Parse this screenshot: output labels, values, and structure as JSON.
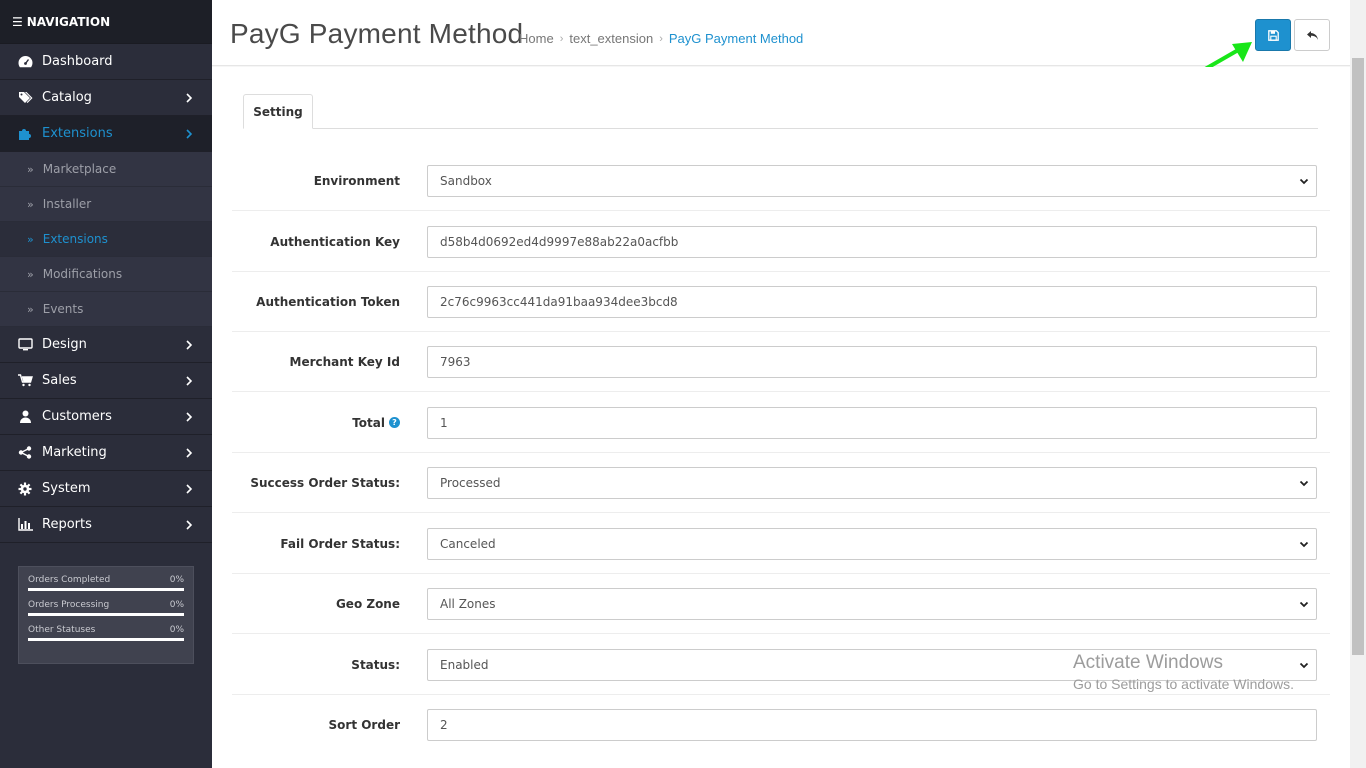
{
  "nav": {
    "title": "NAVIGATION",
    "items": [
      {
        "label": "Dashboard",
        "icon": "dashboard-icon"
      },
      {
        "label": "Catalog",
        "icon": "tags-icon"
      },
      {
        "label": "Extensions",
        "icon": "puzzle-icon"
      },
      {
        "label": "Design",
        "icon": "monitor-icon"
      },
      {
        "label": "Sales",
        "icon": "cart-icon"
      },
      {
        "label": "Customers",
        "icon": "user-icon"
      },
      {
        "label": "Marketing",
        "icon": "share-icon"
      },
      {
        "label": "System",
        "icon": "gear-icon"
      },
      {
        "label": "Reports",
        "icon": "bar-chart-icon"
      }
    ],
    "submenu": [
      "Marketplace",
      "Installer",
      "Extensions",
      "Modifications",
      "Events"
    ],
    "stats": [
      {
        "label": "Orders Completed",
        "value": "0%"
      },
      {
        "label": "Orders Processing",
        "value": "0%"
      },
      {
        "label": "Other Statuses",
        "value": "0%"
      }
    ]
  },
  "header": {
    "title": "PayG Payment Method",
    "breadcrumb": [
      "Home",
      "text_extension",
      "PayG Payment Method"
    ]
  },
  "tabs": [
    {
      "label": "Setting"
    }
  ],
  "form": {
    "environment": {
      "label": "Environment",
      "value": "Sandbox"
    },
    "auth_key": {
      "label": "Authentication Key",
      "value": "d58b4d0692ed4d9997e88ab22a0acfbb"
    },
    "auth_token": {
      "label": "Authentication Token",
      "value": "2c76c9963cc441da91baa934dee3bcd8"
    },
    "merchant_key": {
      "label": "Merchant Key Id",
      "value": "7963"
    },
    "total": {
      "label": "Total",
      "value": "1"
    },
    "success_status": {
      "label": "Success Order Status:",
      "value": "Processed"
    },
    "fail_status": {
      "label": "Fail Order Status:",
      "value": "Canceled"
    },
    "geo_zone": {
      "label": "Geo Zone",
      "value": "All Zones"
    },
    "status": {
      "label": "Status:",
      "value": "Enabled"
    },
    "sort_order": {
      "label": "Sort Order",
      "value": "2"
    }
  },
  "watermark": {
    "line1": "Activate Windows",
    "line2": "Go to Settings to activate Windows."
  },
  "colors": {
    "accent": "#1e91cf",
    "sidebar": "#2b2d3a",
    "arrow": "#19e619"
  }
}
